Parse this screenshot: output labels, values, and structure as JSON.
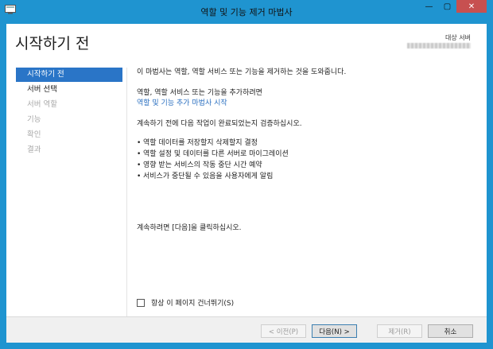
{
  "window": {
    "title": "역할 및 기능 제거 마법사",
    "controls": {
      "minimize": "—",
      "maximize": "▢",
      "close": "✕"
    }
  },
  "header": {
    "page_title": "시작하기 전",
    "target_server_label": "대상 서버"
  },
  "nav": {
    "items": [
      {
        "label": "시작하기 전",
        "state": "active"
      },
      {
        "label": "서버 선택",
        "state": "normal"
      },
      {
        "label": "서버 역할",
        "state": "disabled"
      },
      {
        "label": "기능",
        "state": "disabled"
      },
      {
        "label": "확인",
        "state": "disabled"
      },
      {
        "label": "결과",
        "state": "disabled"
      }
    ]
  },
  "main": {
    "intro": "이 마법사는 역할, 역할 서비스 또는 기능을 제거하는 것을 도와줍니다.",
    "add_text": "역할, 역할 서비스 또는 기능을 추가하려면",
    "add_link": "역할 및 기능 추가 마법사 시작",
    "verify_text": "계속하기 전에 다음 작업이 완료되었는지 검증하십시오.",
    "bullets": [
      "역할 데이터를 저장할지 삭제할지 결정",
      "역할 설정 및 데이터를 다른 서버로 마이그레이션",
      "영향 받는 서비스의 작동 중단 시간 예약",
      "서비스가 중단될 수 있음을 사용자에게 알림"
    ],
    "continue_text": "계속하려면 [다음]을 클릭하십시오."
  },
  "skip": {
    "label": "항상 이 페이지 건너뛰기(S)",
    "checked": false
  },
  "footer": {
    "prev": "< 이전(P)",
    "next": "다음(N) >",
    "remove": "제거(R)",
    "cancel": "취소"
  },
  "colors": {
    "frame": "#1f94d0",
    "nav_active": "#2a75c7",
    "link": "#2a6fc0",
    "close_button": "#c75050"
  }
}
